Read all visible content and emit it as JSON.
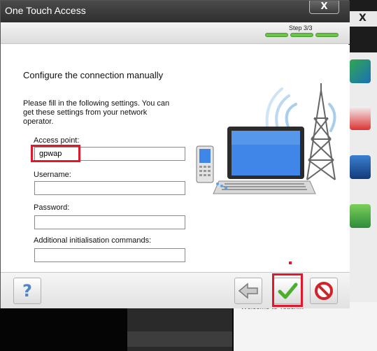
{
  "window": {
    "title": "One Touch Access",
    "close_label": "X"
  },
  "wizard": {
    "step_label": "Step 3/3",
    "step_count": 3,
    "current_step": 3
  },
  "form": {
    "heading": "Configure the connection manually",
    "instructions": "Please fill in the following settings. You can get these settings from your network operator.",
    "access_point": {
      "label": "Access point:",
      "value": "gpwap"
    },
    "username": {
      "label": "Username:",
      "value": ""
    },
    "password": {
      "label": "Password:",
      "value": ""
    },
    "init_commands": {
      "label": "Additional initialisation commands:",
      "value": ""
    }
  },
  "footer": {
    "help_label": "?",
    "back_icon": "back-arrow-icon",
    "finish_icon": "green-checkmark-icon",
    "cancel_icon": "red-cancel-icon"
  },
  "background": {
    "close_label": "X",
    "partial_text": "Welcome to Touch..."
  },
  "colors": {
    "highlight": "#e0182b",
    "progress": "#6cc24a",
    "titlebar": "#3a3a3a"
  }
}
